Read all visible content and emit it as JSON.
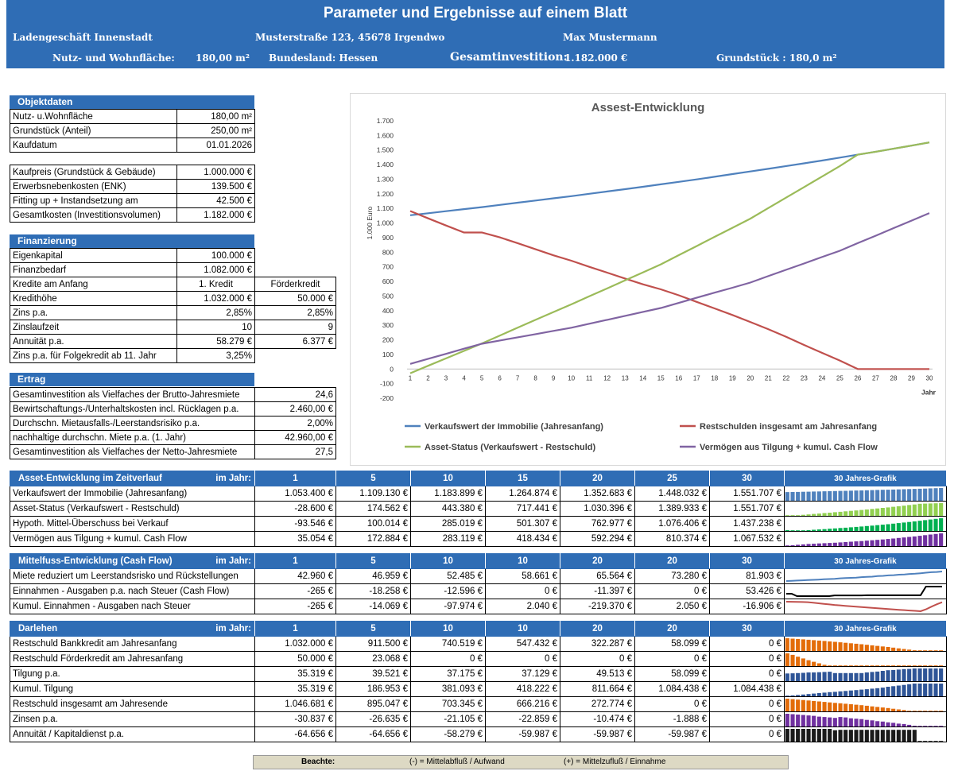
{
  "header": {
    "title": "Parameter und Ergebnisse auf einem Blatt",
    "property": "Ladengeschäft Innenstadt",
    "address": "Musterstraße 123, 45678 Irgendwo",
    "owner": "Max Mustermann",
    "area_label": "Nutz- und Wohnfläche:",
    "area_value": "180,00 m²",
    "state": "Bundesland: Hessen",
    "investment_label": "Gesamtinvestition:",
    "investment_value": "1.182.000 €",
    "plot": "Grundstück : 180,0 m²"
  },
  "objektdaten": {
    "title": "Objektdaten",
    "rows": [
      {
        "label": "Nutz- u.Wohnfläche",
        "value": "180,00 m²"
      },
      {
        "label": "Grundstück (Anteil)",
        "value": "250,00 m²"
      },
      {
        "label": "Kaufdatum",
        "value": "01.01.2026"
      }
    ]
  },
  "kosten": {
    "rows": [
      {
        "label": "Kaufpreis (Grundstück & Gebäude)",
        "value": "1.000.000 €"
      },
      {
        "label": "Erwerbsnebenkosten (ENK)",
        "value": "139.500 €"
      },
      {
        "label": "Fitting up + Instandsetzung am",
        "value": "42.500 €"
      },
      {
        "label": "Gesamtkosten (Investitionsvolumen)",
        "value": "1.182.000 €"
      }
    ]
  },
  "finanzierung": {
    "title": "Finanzierung",
    "rows": [
      {
        "label": "Eigenkapital",
        "v1": "100.000 €",
        "v2": ""
      },
      {
        "label": "Finanzbedarf",
        "v1": "1.082.000 €",
        "v2": ""
      },
      {
        "label": "Kredite am Anfang",
        "v1": "1. Kredit",
        "v2": "Förderkredit"
      },
      {
        "label": "Kredithöhe",
        "v1": "1.032.000 €",
        "v2": "50.000 €"
      },
      {
        "label": "Zins p.a.",
        "v1": "2,85%",
        "v2": "2,85%"
      },
      {
        "label": "Zinslaufzeit",
        "v1": "10",
        "v2": "9"
      },
      {
        "label": "Annuität p.a.",
        "v1": "58.279 €",
        "v2": "6.377 €"
      },
      {
        "label": "Zins p.a. für Folgekredit ab 11. Jahr",
        "v1": "3,25%",
        "v2": ""
      }
    ]
  },
  "ertrag": {
    "title": "Ertrag",
    "rows": [
      {
        "label": "Gesamtinvestition als Vielfaches der Brutto-Jahresmiete",
        "value": "24,6"
      },
      {
        "label": "Bewirtschaftungs-/Unterhaltskosten incl. Rücklagen p.a.",
        "value": "2.460,00 €"
      },
      {
        "label": "Durchschn. Mietausfalls-/Leerstandsrisiko p.a.",
        "value": "2,00%"
      },
      {
        "label": "nachhaltige durchschn. Miete p.a. (1. Jahr)",
        "value": "42.960,00 €"
      },
      {
        "label": "Gesamtinvestition als Vielfaches der Netto-Jahresmiete",
        "value": "27,5"
      }
    ]
  },
  "asset": {
    "title": "Asset-Entwicklung im Zeitverlauf",
    "im_jahr": "im  Jahr:",
    "years": [
      "1",
      "5",
      "10",
      "15",
      "20",
      "25",
      "30"
    ],
    "graph_label": "30 Jahres-Grafik",
    "rows": [
      {
        "label": "Verkaufswert der Immobilie (Jahresanfang)",
        "values": [
          "1.053.400 €",
          "1.109.130 €",
          "1.183.899 €",
          "1.264.874 €",
          "1.352.683 €",
          "1.448.032 €",
          "1.551.707 €"
        ],
        "color": "#4f81bd",
        "series": [
          1053,
          1067,
          1081,
          1095,
          1109,
          1124,
          1139,
          1154,
          1169,
          1184,
          1200,
          1216,
          1232,
          1248,
          1265,
          1282,
          1299,
          1317,
          1335,
          1353,
          1371,
          1390,
          1409,
          1428,
          1448,
          1468,
          1488,
          1509,
          1530,
          1552
        ]
      },
      {
        "label": "Asset-Status (Verkaufswert - Restschuld)",
        "values": [
          "-28.600 €",
          "174.562 €",
          "443.380 €",
          "717.441 €",
          "1.030.396 €",
          "1.389.933 €",
          "1.551.707 €"
        ],
        "color": "#92d050",
        "series": [
          -29,
          22,
          73,
          124,
          175,
          229,
          283,
          337,
          390,
          443,
          498,
          552,
          607,
          662,
          717,
          780,
          842,
          905,
          967,
          1030,
          1102,
          1174,
          1246,
          1318,
          1390,
          1470,
          1490,
          1510,
          1530,
          1552
        ]
      },
      {
        "label": "Hypoth. Mittel-Überschuss bei Verkauf",
        "values": [
          "-93.546 €",
          "100.014 €",
          "285.019 €",
          "501.307 €",
          "762.977 €",
          "1.076.406 €",
          "1.437.238 €"
        ],
        "color": "#00b050",
        "series": [
          -94,
          -45,
          3,
          52,
          100,
          137,
          174,
          211,
          248,
          285,
          328,
          371,
          415,
          458,
          501,
          553,
          606,
          658,
          711,
          763,
          826,
          888,
          951,
          1014,
          1076,
          1148,
          1221,
          1293,
          1365,
          1437
        ]
      },
      {
        "label": "Vermögen aus Tilgung + kumul. Cash Flow",
        "values": [
          "35.054 €",
          "172.884 €",
          "283.119 €",
          "418.434 €",
          "592.294 €",
          "810.374 €",
          "1.067.532 €"
        ],
        "color": "#7030a0",
        "series": [
          35,
          70,
          104,
          139,
          173,
          195,
          217,
          239,
          261,
          283,
          310,
          337,
          364,
          391,
          418,
          453,
          488,
          523,
          557,
          592,
          636,
          680,
          723,
          767,
          810,
          862,
          913,
          965,
          1016,
          1068
        ]
      }
    ]
  },
  "cashflow": {
    "title": "Mittelfuss-Entwicklung (Cash Flow)",
    "im_jahr": "im Jahr:",
    "years": [
      "1",
      "5",
      "10",
      "10",
      "20",
      "20",
      "30"
    ],
    "graph_label": "30 Jahres-Grafik",
    "rows": [
      {
        "label": "Miete reduziert um Leerstandsrisko und Rückstellungen",
        "values": [
          "42.960 €",
          "46.959 €",
          "52.485 €",
          "58.661 €",
          "65.564 €",
          "73.280 €",
          "81.903 €"
        ],
        "color": "#4f81bd",
        "series": [
          43,
          44,
          45,
          46,
          47,
          48,
          49,
          50,
          51,
          52,
          54,
          55,
          56,
          57,
          59,
          60,
          61,
          63,
          64,
          66,
          67,
          69,
          70,
          72,
          73,
          75,
          77,
          79,
          80,
          82
        ]
      },
      {
        "label": "Einnahmen - Ausgaben p.a. nach Steuer (Cash Flow)",
        "values": [
          "-265 €",
          "-18.258 €",
          "-12.596 €",
          "0 €",
          "-11.397 €",
          "0 €",
          "53.426 €"
        ],
        "color": "#000000",
        "series": [
          -265,
          -265,
          -18258,
          -18258,
          -18258,
          -18258,
          -18258,
          -18258,
          -18258,
          -12596,
          -12596,
          -12596,
          -12596,
          -12596,
          -12596,
          -11397,
          -11397,
          -11397,
          -11397,
          -11397,
          -11397,
          -11397,
          -11397,
          -11397,
          -11397,
          -11397,
          53426,
          53426,
          53426,
          53426
        ]
      },
      {
        "label": "Kumul. Einnahmen - Ausgaben nach Steuer",
        "values": [
          "-265 €",
          "-14.069 €",
          "-97.974 €",
          "2.040 €",
          "-219.370 €",
          "2.050 €",
          "-16.906 €"
        ],
        "color": "#c0504d",
        "series": [
          -265,
          -3000,
          -6000,
          -10000,
          -14069,
          -30000,
          -47000,
          -64000,
          -81000,
          -97974,
          -110000,
          -123000,
          -136000,
          -149000,
          -162000,
          -173000,
          -184000,
          -196000,
          -208000,
          -219370,
          -231000,
          -242000,
          -253000,
          -264000,
          -275000,
          -286000,
          -230000,
          -150000,
          -80000,
          -16906
        ]
      }
    ]
  },
  "darlehen": {
    "title": "Darlehen",
    "im_jahr": "im Jahr:",
    "years": [
      "1",
      "5",
      "10",
      "10",
      "20",
      "20",
      "30"
    ],
    "graph_label": "30 Jahres-Grafik",
    "rows": [
      {
        "label": "Restschuld Bankkredit am Jahresanfang",
        "values": [
          "1.032.000 €",
          "911.500 €",
          "740.519 €",
          "547.432 €",
          "322.287 €",
          "58.099 €",
          "0 €"
        ],
        "color": "#e36c09",
        "series": [
          1032,
          1002,
          972,
          942,
          912,
          878,
          844,
          810,
          775,
          741,
          702,
          663,
          625,
          586,
          547,
          502,
          457,
          412,
          367,
          322,
          269,
          216,
          164,
          111,
          58,
          0,
          0,
          0,
          0,
          0
        ]
      },
      {
        "label": "Restschuld Förderkredit am Jahresanfang",
        "values": [
          "50.000 €",
          "23.068 €",
          "0 €",
          "0 €",
          "0 €",
          "0 €",
          "0 €"
        ],
        "color": "#e36c09",
        "series": [
          50,
          44,
          37,
          30,
          23,
          17,
          11,
          5,
          0,
          0,
          0,
          0,
          0,
          0,
          0,
          0,
          0,
          0,
          0,
          0,
          0,
          0,
          0,
          0,
          0,
          0,
          0,
          0,
          0,
          0
        ]
      },
      {
        "label": "Tilgung p.a.",
        "values": [
          "35.319 €",
          "39.521 €",
          "37.175 €",
          "37.129 €",
          "49.513 €",
          "58.099 €",
          "0 €"
        ],
        "color": "#2f5597",
        "series": [
          35,
          36,
          37,
          38,
          40,
          40,
          41,
          42,
          43,
          37,
          37,
          37,
          37,
          37,
          37,
          40,
          42,
          44,
          47,
          50,
          51,
          53,
          55,
          56,
          58,
          58,
          58,
          58,
          58,
          58
        ]
      },
      {
        "label": "Kumul. Tilgung",
        "values": [
          "35.319 €",
          "186.953 €",
          "381.093 €",
          "418.222 €",
          "811.664 €",
          "1.084.438 €",
          "1.084.438 €"
        ],
        "color": "#2f5597",
        "series": [
          35,
          72,
          109,
          147,
          187,
          227,
          268,
          310,
          353,
          381,
          418,
          455,
          492,
          529,
          566,
          606,
          648,
          692,
          739,
          812,
          863,
          916,
          971,
          1027,
          1084,
          1084,
          1084,
          1084,
          1084,
          1084
        ]
      },
      {
        "label": "Restschuld insgesamt am Jahresende",
        "values": [
          "1.046.681 €",
          "895.047 €",
          "703.345 €",
          "666.216 €",
          "272.774 €",
          "0 €",
          "0 €"
        ],
        "color": "#e36c09",
        "series": [
          1047,
          1009,
          971,
          933,
          895,
          857,
          818,
          780,
          742,
          703,
          666,
          627,
          588,
          549,
          510,
          463,
          415,
          368,
          320,
          273,
          218,
          164,
          109,
          55,
          0,
          0,
          0,
          0,
          0,
          0
        ]
      },
      {
        "label": "Zinsen p.a.",
        "values": [
          "-30.837 €",
          "-26.635 €",
          "-21.105 €",
          "-22.859 €",
          "-10.474 €",
          "-1.888 €",
          "0 €"
        ],
        "color": "#7030a0",
        "series": [
          31,
          30,
          29,
          28,
          27,
          26,
          24,
          23,
          22,
          21,
          23,
          22,
          20,
          19,
          18,
          16,
          15,
          13,
          12,
          10,
          9,
          7,
          6,
          4,
          2,
          0,
          0,
          0,
          0,
          0
        ]
      },
      {
        "label": "Annuität / Kapitaldienst p.a.",
        "values": [
          "-64.656 €",
          "-64.656 €",
          "-58.279 €",
          "-59.987 €",
          "-59.987 €",
          "-59.987 €",
          "0 €"
        ],
        "color": "#1a1a1a",
        "series": [
          65,
          65,
          65,
          65,
          65,
          65,
          65,
          65,
          65,
          58,
          60,
          60,
          60,
          60,
          60,
          60,
          60,
          60,
          60,
          60,
          60,
          60,
          60,
          60,
          60,
          0,
          0,
          0,
          0,
          0
        ]
      }
    ]
  },
  "note": {
    "label": "Beachte:",
    "minus": "(-) = Mittelabfluß / Aufwand",
    "plus": "(+) = Mittelzufluß / Einnahme"
  },
  "chart_data": {
    "type": "line",
    "title": "Assest-Entwicklung",
    "ylabel": "1.000 Euro",
    "xlabel": "Jahr",
    "ylim": [
      -200,
      1700
    ],
    "yticks": [
      "1.700",
      "1.600",
      "1.500",
      "1.400",
      "1.300",
      "1.200",
      "1.100",
      "1.000",
      "900",
      "800",
      "700",
      "600",
      "500",
      "400",
      "300",
      "200",
      "100",
      "0",
      "-100",
      "-200"
    ],
    "x": [
      1,
      2,
      3,
      4,
      5,
      6,
      7,
      8,
      9,
      10,
      11,
      12,
      13,
      14,
      15,
      16,
      17,
      18,
      19,
      20,
      21,
      22,
      23,
      24,
      25,
      26,
      27,
      28,
      29,
      30
    ],
    "series": [
      {
        "name": "Verkaufswert der Immobilie (Jahresanfang)",
        "color": "#4f81bd",
        "values": [
          1053,
          1067,
          1081,
          1095,
          1109,
          1124,
          1139,
          1154,
          1169,
          1184,
          1200,
          1216,
          1232,
          1248,
          1265,
          1282,
          1299,
          1317,
          1335,
          1353,
          1371,
          1390,
          1409,
          1428,
          1448,
          1468,
          1488,
          1509,
          1530,
          1552
        ]
      },
      {
        "name": "Restschulden insgesamt am Jahresanfang",
        "color": "#c0504d",
        "values": [
          1082,
          1032,
          983,
          935,
          935,
          902,
          862,
          820,
          779,
          742,
          700,
          660,
          620,
          580,
          546,
          505,
          460,
          415,
          370,
          322,
          273,
          221,
          165,
          111,
          58,
          0,
          0,
          0,
          0,
          0
        ]
      },
      {
        "name": "Asset-Status (Verkaufswert - Restschuld)",
        "color": "#9bbb59",
        "values": [
          -29,
          22,
          73,
          124,
          175,
          229,
          283,
          337,
          390,
          443,
          498,
          552,
          607,
          662,
          717,
          780,
          842,
          905,
          967,
          1030,
          1102,
          1174,
          1246,
          1318,
          1390,
          1468,
          1488,
          1509,
          1530,
          1552
        ]
      },
      {
        "name": "Vermögen aus Tilgung + kumul. Cash Flow",
        "color": "#8064a2",
        "values": [
          35,
          70,
          104,
          139,
          173,
          195,
          217,
          239,
          261,
          283,
          310,
          337,
          364,
          391,
          418,
          453,
          488,
          523,
          557,
          592,
          636,
          680,
          723,
          767,
          810,
          862,
          913,
          965,
          1016,
          1068
        ]
      }
    ]
  }
}
